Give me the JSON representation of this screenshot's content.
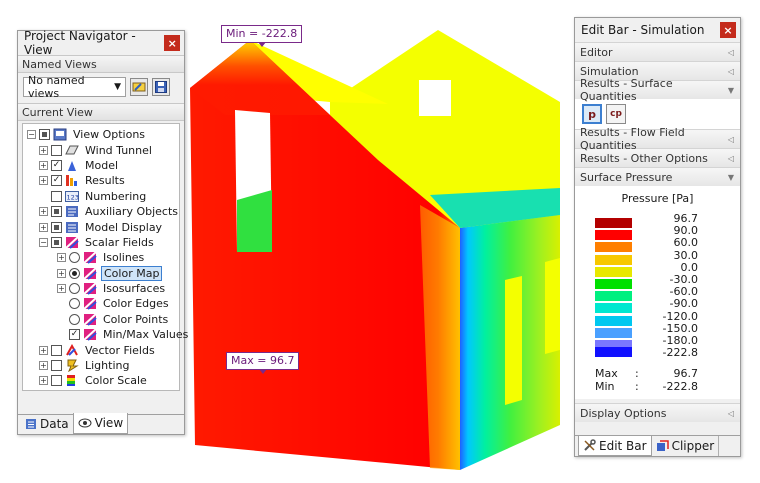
{
  "callouts": {
    "min_label": "Min = -222.8",
    "max_label": "Max = 96.7"
  },
  "navigator": {
    "title": "Project Navigator - View",
    "named_views_header": "Named Views",
    "named_views_value": "No named views",
    "current_view_header": "Current View",
    "tree": {
      "view_options": "View Options",
      "wind_tunnel": "Wind Tunnel",
      "model": "Model",
      "results": "Results",
      "numbering": "Numbering",
      "auxiliary_objects": "Auxiliary Objects",
      "model_display": "Model Display",
      "scalar_fields": "Scalar Fields",
      "isolines": "Isolines",
      "color_map": "Color Map",
      "isosurfaces": "Isosurfaces",
      "color_edges": "Color Edges",
      "color_points": "Color Points",
      "min_max_values": "Min/Max Values",
      "vector_fields": "Vector Fields",
      "lighting": "Lighting",
      "color_scale": "Color Scale"
    },
    "tabs": {
      "data": "Data",
      "view": "View"
    }
  },
  "editbar": {
    "title": "Edit Bar - Simulation",
    "sections": {
      "editor": "Editor",
      "simulation": "Simulation",
      "surface_quantities": "Results - Surface Quantities",
      "flow_field": "Results - Flow Field Quantities",
      "other_options": "Results - Other Options",
      "surface_pressure": "Surface Pressure",
      "display_options": "Display Options"
    },
    "buttons": {
      "p": "p",
      "cp": "cp"
    },
    "legend": {
      "title": "Pressure [Pa]",
      "values": [
        "96.7",
        "90.0",
        "60.0",
        "30.0",
        "0.0",
        "-30.0",
        "-60.0",
        "-90.0",
        "-120.0",
        "-150.0",
        "-180.0",
        "-222.8"
      ],
      "colors": [
        "#b30000",
        "#ff0000",
        "#ff7f00",
        "#f7c800",
        "#e8e800",
        "#00e000",
        "#00f080",
        "#00e8d0",
        "#00c8f0",
        "#4aa0ff",
        "#7a78ff",
        "#1010ff"
      ],
      "max_label": "Max",
      "max_value": "96.7",
      "min_label": "Min",
      "min_value": "-222.8",
      "separator": ":"
    },
    "tabs": {
      "edit_bar": "Edit Bar",
      "clipper": "Clipper"
    }
  }
}
